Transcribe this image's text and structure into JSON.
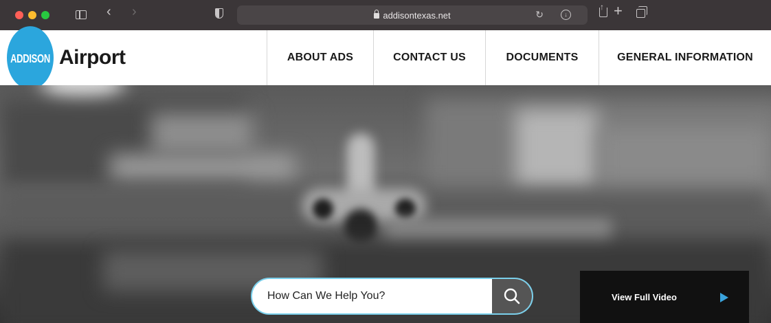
{
  "browser": {
    "url": "addisontexas.net"
  },
  "site": {
    "logo_badge": "ADDISON",
    "logo_text": "Airport"
  },
  "nav": {
    "items": [
      {
        "label": "ABOUT ADS"
      },
      {
        "label": "CONTACT US"
      },
      {
        "label": "DOCUMENTS"
      },
      {
        "label": "GENERAL INFORMATION"
      }
    ]
  },
  "hero": {
    "search_placeholder": "How Can We Help You?",
    "video_label": "View Full Video"
  },
  "colors": {
    "brand_blue": "#2ba6dd",
    "play_blue": "#3aa3dc",
    "search_border": "#7ad0ec"
  },
  "icons": [
    "sidebar-icon",
    "back-icon",
    "forward-icon",
    "shield-icon",
    "lock-icon",
    "reload-icon",
    "download-icon",
    "share-icon",
    "plus-icon",
    "tabs-icon",
    "search-icon",
    "play-icon"
  ]
}
